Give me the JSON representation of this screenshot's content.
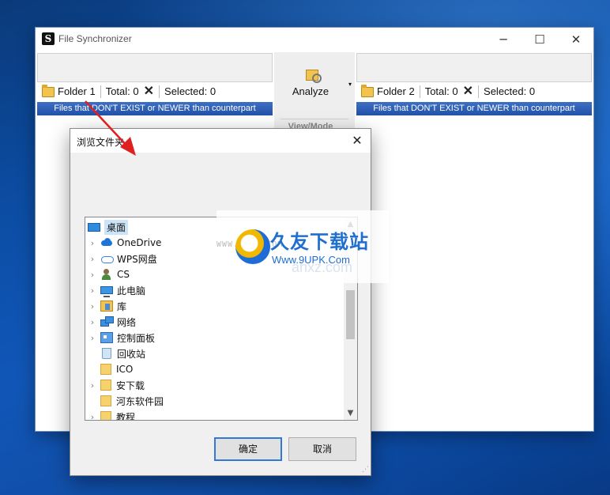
{
  "app": {
    "title": "File Synchronizer",
    "icon": "app-icon"
  },
  "window_controls": {
    "minimize": "─",
    "maximize": "☐",
    "close": "✕"
  },
  "left_panel": {
    "folder_label": "Folder 1",
    "total": "Total: 0",
    "selected": "Selected: 0",
    "filter": "Files that DON'T EXIST or NEWER than counterpart"
  },
  "right_panel": {
    "folder_label": "Folder 2",
    "total": "Total: 0",
    "selected": "Selected: 0",
    "filter": "Files that DON'T EXIST or NEWER than counterpart"
  },
  "toolbar": {
    "analyze": "Analyze",
    "view_mode": "View/Mode",
    "dropdown": "▾"
  },
  "dialog": {
    "title": "浏览文件夹",
    "tree": [
      {
        "label": "桌面",
        "icon": "desktop-icon",
        "expandable": false,
        "selected": true
      },
      {
        "label": "OneDrive",
        "icon": "onedrive-icon",
        "expandable": true
      },
      {
        "label": "WPS网盘",
        "icon": "wps-cloud-icon",
        "expandable": true
      },
      {
        "label": "CS",
        "icon": "user-icon",
        "expandable": true
      },
      {
        "label": "此电脑",
        "icon": "computer-icon",
        "expandable": true
      },
      {
        "label": "库",
        "icon": "library-icon",
        "expandable": true
      },
      {
        "label": "网络",
        "icon": "network-icon",
        "expandable": true
      },
      {
        "label": "控制面板",
        "icon": "control-panel-icon",
        "expandable": true
      },
      {
        "label": "回收站",
        "icon": "recycle-bin-icon",
        "expandable": false
      },
      {
        "label": "ICO",
        "icon": "folder-icon",
        "expandable": false
      },
      {
        "label": "安下载",
        "icon": "folder-icon",
        "expandable": true
      },
      {
        "label": "河东软件园",
        "icon": "folder-icon",
        "expandable": false
      },
      {
        "label": "教程",
        "icon": "folder-icon",
        "expandable": true
      }
    ],
    "ok": "确定",
    "cancel": "取消"
  },
  "watermark": {
    "title": "久友下载站",
    "url": "Www.9UPK.Com",
    "small": "WWW.9UPK.COM",
    "ghost": "anxz.com"
  },
  "colors": {
    "filter_bar": "#2152a8",
    "primary_border": "#3379d1",
    "arrow": "#e02020"
  }
}
